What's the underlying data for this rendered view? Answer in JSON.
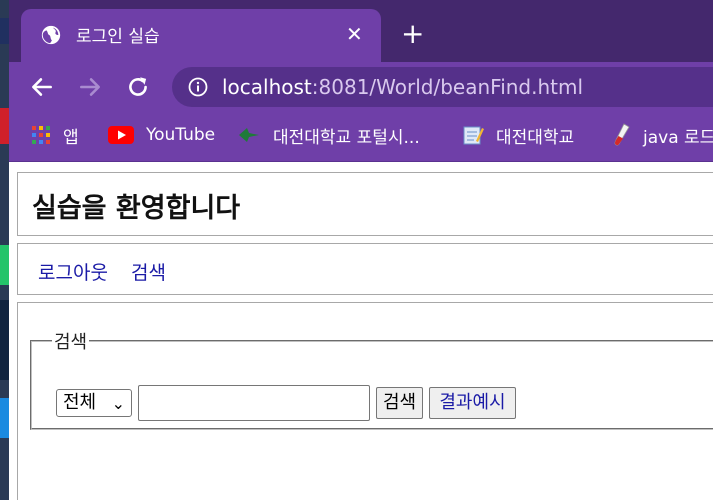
{
  "browser": {
    "tab_title": "로그인 실습",
    "url_host": "localhost",
    "url_rest": ":8081/World/beanFind.html",
    "accent": "#6f3fa8",
    "bookmarks": [
      {
        "label": "앱",
        "icon": "apps-grid-icon"
      },
      {
        "label": "YouTube",
        "icon": "youtube-icon"
      },
      {
        "label": "대전대학교 포털시...",
        "icon": "leaf-icon"
      },
      {
        "label": "대전대학교",
        "icon": "notepad-icon"
      },
      {
        "label": "java 로드",
        "icon": "test-tube-icon"
      }
    ]
  },
  "header": {
    "title": "실습을 환영합니다"
  },
  "nav": {
    "logout": "로그아웃",
    "search": "검색"
  },
  "search": {
    "legend": "검색",
    "select_value": "전체",
    "query_value": "",
    "search_button": "검색",
    "result_button": "결과예시"
  }
}
